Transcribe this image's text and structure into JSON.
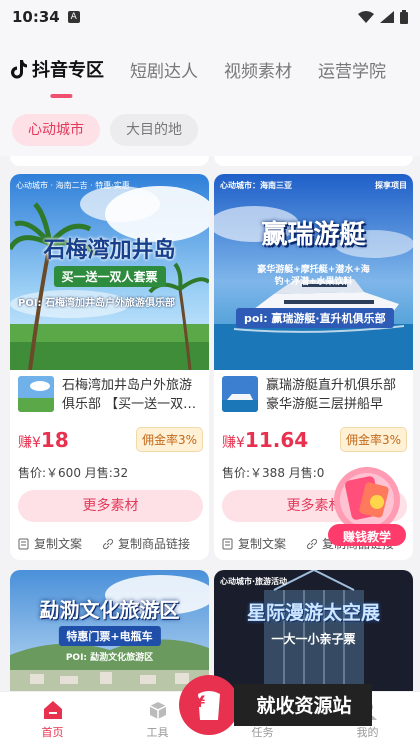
{
  "status": {
    "time": "10:34",
    "sim": "A"
  },
  "tabs": [
    {
      "label": "抖音专区",
      "active": true
    },
    {
      "label": "短剧达人"
    },
    {
      "label": "视频素材"
    },
    {
      "label": "运营学院"
    }
  ],
  "subtabs": [
    "心动城市",
    "大目的地"
  ],
  "cards": [
    {
      "banner_tag": "心动城市 · 海南二吉 · 特惠·实惠",
      "banner_title": "石梅湾加井岛",
      "banner_subtitle": "买一送一双人套票",
      "banner_poi": "POI: 石梅湾加井岛户外旅游俱乐部",
      "title": "石梅湾加井岛户外旅游俱乐部 【买一送一双…",
      "earn_prefix": "赚¥",
      "earn_value": "18",
      "rate": "佣金率3%",
      "price": "售价:￥600  月售:32",
      "more_label": "更多素材",
      "copy_text": "复制文案",
      "copy_link": "复制商品链接"
    },
    {
      "banner_tag": "心动城市：海南三亚",
      "banner_tag_right": "探享项目",
      "banner_title": "赢瑞游艇",
      "banner_subtitle": "豪华游艇+摩托艇+潜水+海钓+浮潜+水果饮料",
      "banner_poi": "poi: 赢瑞游艇·直升机俱乐部",
      "title": "赢瑞游艇直升机俱乐部 豪华游艇三层拼船早班…",
      "earn_prefix": "赚¥",
      "earn_value": "11.64",
      "rate": "佣金率3%",
      "price": "售价:￥388  月售:0",
      "more_label": "更多素材",
      "copy_text": "复制文案",
      "copy_link": "复制商品链接"
    },
    {
      "banner_title": "勐泐文化旅游区",
      "banner_subtitle": "特惠门票+电瓶车",
      "banner_poi": "POI: 勐泐文化旅游区"
    },
    {
      "banner_tag": "心动城市·旅游活动",
      "banner_title": "星际漫游太空展",
      "banner_subtitle": "一大一小亲子票"
    }
  ],
  "floating_badge": {
    "label": "赚钱教学"
  },
  "watermark": {
    "label": "就收资源站"
  },
  "bottom_nav": [
    {
      "label": "首页",
      "active": true
    },
    {
      "label": "工具"
    },
    {
      "label": "任务"
    },
    {
      "label": "我的"
    }
  ],
  "colors": {
    "accent": "#e8314e",
    "accent_light": "#fde1e6",
    "rate_bg": "#fff1d6"
  }
}
